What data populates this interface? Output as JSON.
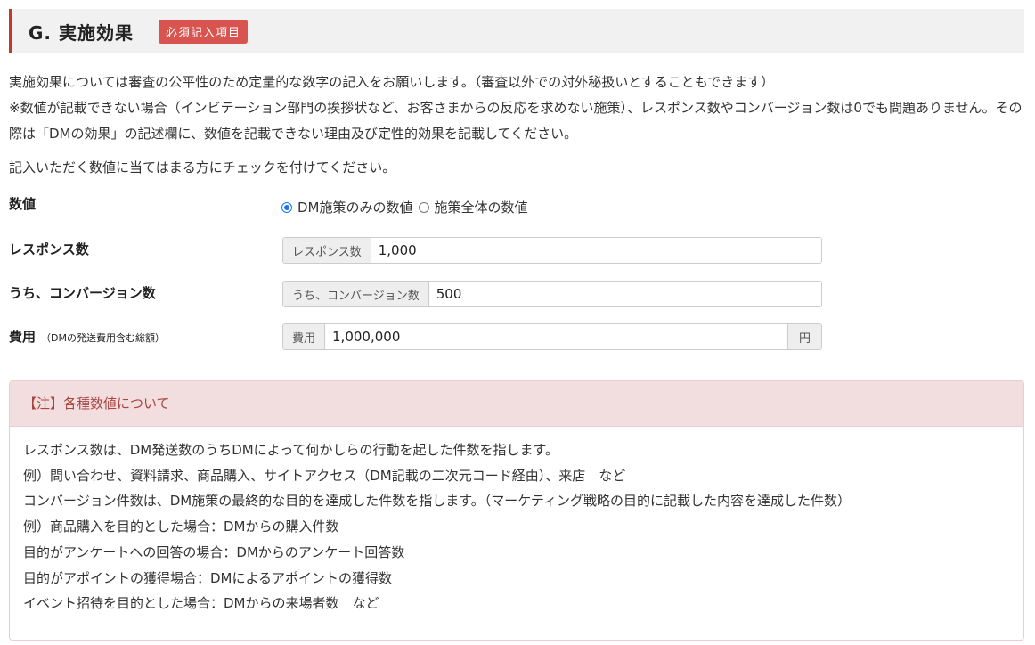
{
  "section": {
    "title": "G. 実施効果",
    "badge": "必須記入項目"
  },
  "intro": {
    "line1": "実施効果については審査の公平性のため定量的な数字の記入をお願いします。（審査以外での対外秘扱いとすることもできます）",
    "line2": "※数値が記載できない場合（インビテーション部門の挨拶状など、お客さまからの反応を求めない施策）、レスポンス数やコンバージョン数は0でも問題ありません。その際は「DMの効果」の記述欄に、数値を記載できない理由及び定性的効果を記載してください。",
    "line3": "記入いただく数値に当てはまる方にチェックを付けてください。"
  },
  "fields": {
    "numeric_type": {
      "label": "数値",
      "options": [
        "DM施策のみの数値",
        "施策全体の数値"
      ],
      "selected": "DM施策のみの数値"
    },
    "response": {
      "label": "レスポンス数",
      "addon": "レスポンス数",
      "value": "1,000"
    },
    "conversion": {
      "label": "うち、コンバージョン数",
      "addon": "うち、コンバージョン数",
      "value": "500"
    },
    "cost": {
      "label": "費用",
      "sublabel": "（DMの発送費用含む総額）",
      "addon": "費用",
      "value": "1,000,000",
      "unit": "円"
    }
  },
  "note": {
    "heading": "【注】各種数値について",
    "lines": [
      "レスポンス数は、DM発送数のうちDMによって何かしらの行動を起した件数を指します。",
      "例）問い合わせ、資料請求、商品購入、サイトアクセス（DM記載の二次元コード経由）、来店　など",
      "コンバージョン件数は、DM施策の最終的な目的を達成した件数を指します。（マーケティング戦略の目的に記載した内容を達成した件数）",
      "例）商品購入を目的とした場合：DMからの購入件数",
      "目的がアンケートへの回答の場合：DMからのアンケート回答数",
      "目的がアポイントの獲得場合：DMによるアポイントの獲得数",
      "イベント招待を目的とした場合：DMからの来場者数　など"
    ]
  },
  "colors": {
    "accent": "#c0392b",
    "badge": "#d9534f",
    "note_bg": "#f2dede",
    "note_text": "#a94442",
    "radio": "#1a73e8"
  }
}
